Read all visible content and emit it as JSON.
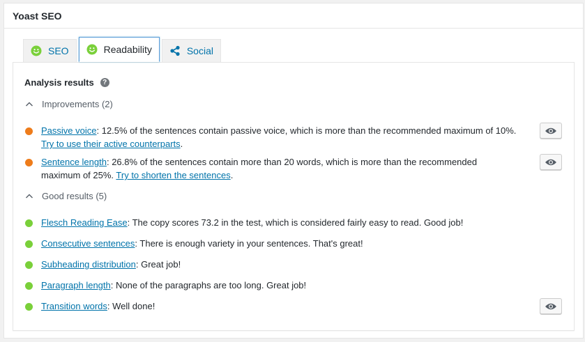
{
  "metabox": {
    "title": "Yoast SEO"
  },
  "tabs": [
    {
      "label": "SEO",
      "icon": "smiley-icon",
      "active": false
    },
    {
      "label": "Readability",
      "icon": "smiley-icon",
      "active": true
    },
    {
      "label": "Social",
      "icon": "share-icon",
      "active": false
    }
  ],
  "colors": {
    "good": "#7ad03a",
    "ok": "#ee7c1b",
    "link": "#0073aa",
    "tab_active_border": "#5b9dd9"
  },
  "analysis": {
    "title": "Analysis results",
    "help_icon": "?",
    "improvements": {
      "label": "Improvements (2)",
      "items": [
        {
          "status": "orange",
          "link": "Passive voice",
          "text": ": 12.5% of the sentences contain passive voice, which is more than the recommended maximum of 10%. ",
          "tip": "Try to use their active counterparts",
          "end": "."
        },
        {
          "status": "orange",
          "link": "Sentence length",
          "text": ": 26.8% of the sentences contain more than 20 words, which is more than the recommended maximum of 25%. ",
          "tip": "Try to shorten the sentences",
          "end": "."
        }
      ]
    },
    "good": {
      "label": "Good results (5)",
      "items": [
        {
          "status": "green",
          "link": "Flesch Reading Ease",
          "text": ": The copy scores 73.2 in the test, which is considered fairly easy to read. Good job!"
        },
        {
          "status": "green",
          "link": "Consecutive sentences",
          "text": ": There is enough variety in your sentences. That's great!"
        },
        {
          "status": "green",
          "link": "Subheading distribution",
          "text": ": Great job!"
        },
        {
          "status": "green",
          "link": "Paragraph length",
          "text": ": None of the paragraphs are too long. Great job!"
        },
        {
          "status": "green",
          "link": "Transition words",
          "text": ": Well done!"
        }
      ]
    }
  }
}
